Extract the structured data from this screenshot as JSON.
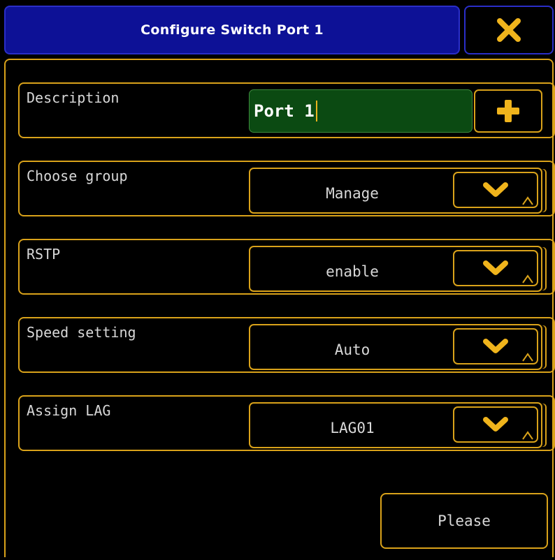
{
  "dialog": {
    "title": "Configure Switch Port 1",
    "close_icon": "close-icon"
  },
  "fields": {
    "description": {
      "label": "Description",
      "value": "Port 1",
      "add_icon": "plus-icon"
    },
    "choose_group": {
      "label": "Choose group",
      "value": "Manage"
    },
    "rstp": {
      "label": "RSTP",
      "value": "enable"
    },
    "speed_setting": {
      "label": "Speed setting",
      "value": "Auto"
    },
    "assign_lag": {
      "label": "Assign LAG",
      "value": "LAG01"
    }
  },
  "actions": {
    "ok_label": "Please"
  },
  "colors": {
    "title_bar": "#0d1196",
    "accent": "#d9a21a",
    "input_bg": "#0b4a12",
    "icon": "#f0b41c"
  }
}
